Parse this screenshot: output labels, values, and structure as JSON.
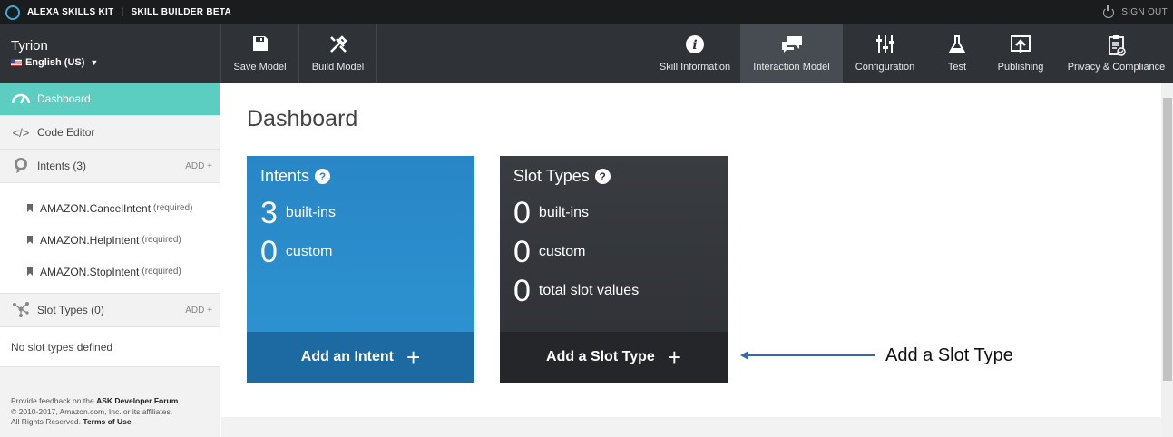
{
  "topbar": {
    "brand": "ALEXA SKILLS KIT",
    "product": "SKILL BUILDER BETA",
    "signout": "SIGN OUT"
  },
  "header": {
    "skill_name": "Tyrion",
    "language": "English (US)",
    "actions": [
      {
        "label": "Save Model",
        "icon": "save-icon"
      },
      {
        "label": "Build Model",
        "icon": "tools-icon"
      }
    ],
    "nav": [
      {
        "label": "Skill Information",
        "icon": "info-icon"
      },
      {
        "label": "Interaction Model",
        "icon": "chat-icon",
        "active": true
      },
      {
        "label": "Configuration",
        "icon": "sliders-icon"
      },
      {
        "label": "Test",
        "icon": "flask-icon"
      },
      {
        "label": "Publishing",
        "icon": "upload-icon"
      },
      {
        "label": "Privacy & Compliance",
        "icon": "clipboard-icon"
      }
    ]
  },
  "sidebar": {
    "dashboard": "Dashboard",
    "code_editor": "Code Editor",
    "intents_label": "Intents (3)",
    "add_label": "ADD",
    "intents": [
      {
        "name": "AMAZON.CancelIntent",
        "tag": "(required)"
      },
      {
        "name": "AMAZON.HelpIntent",
        "tag": "(required)"
      },
      {
        "name": "AMAZON.StopIntent",
        "tag": "(required)"
      }
    ],
    "slot_types_label": "Slot Types (0)",
    "no_slots": "No slot types defined",
    "footer": {
      "feedback_prefix": "Provide feedback on the",
      "forum": "ASK Developer Forum",
      "copyright": "© 2010-2017, Amazon.com, Inc. or its affiliates.",
      "rights": "All Rights Reserved.",
      "terms": "Terms of Use"
    }
  },
  "main": {
    "title": "Dashboard",
    "intents_card": {
      "title": "Intents",
      "builtins_count": "3",
      "builtins_label": "built-ins",
      "custom_count": "0",
      "custom_label": "custom",
      "action": "Add an Intent"
    },
    "slots_card": {
      "title": "Slot Types",
      "builtins_count": "0",
      "builtins_label": "built-ins",
      "custom_count": "0",
      "custom_label": "custom",
      "values_count": "0",
      "values_label": "total slot values",
      "action": "Add a Slot Type"
    },
    "annotation": "Add a Slot Type"
  },
  "colors": {
    "accent": "#5bcec1",
    "blue_card": "#2886c6",
    "dark_card": "#393c41",
    "arrow": "#3a66b0"
  }
}
